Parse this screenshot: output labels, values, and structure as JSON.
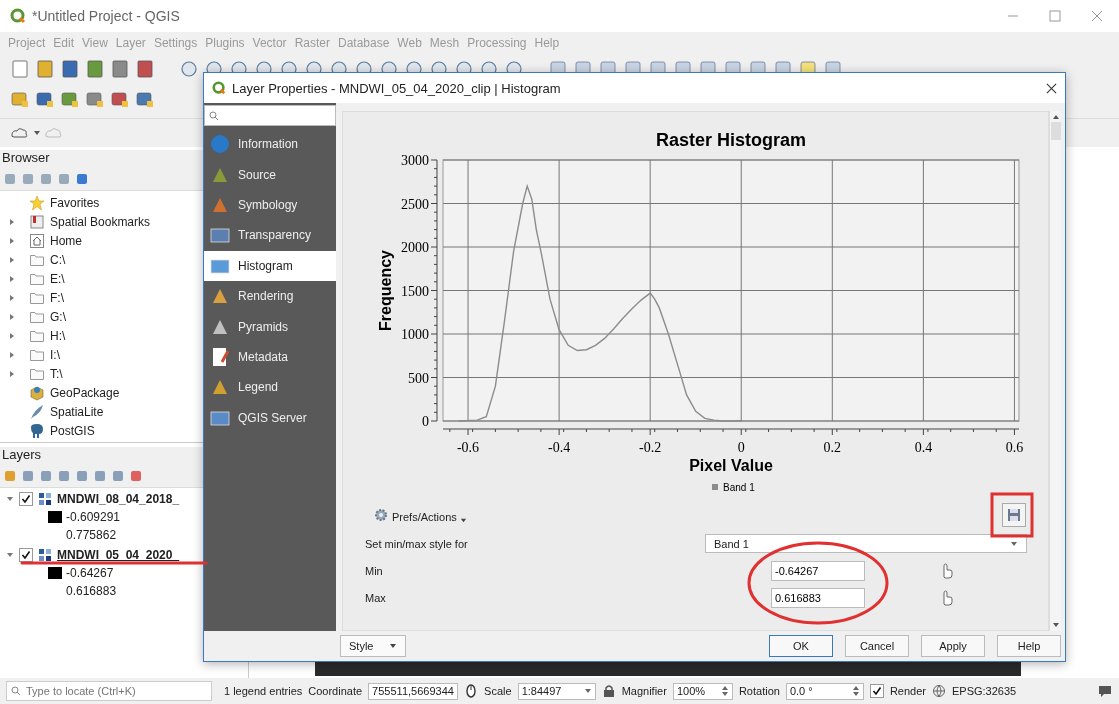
{
  "window": {
    "title": "*Untitled Project - QGIS"
  },
  "menu": [
    "Project",
    "Edit",
    "View",
    "Layer",
    "Settings",
    "Plugins",
    "Vector",
    "Raster",
    "Database",
    "Web",
    "Mesh",
    "Processing",
    "Help"
  ],
  "browser": {
    "title": "Browser",
    "items": [
      {
        "label": "Favorites"
      },
      {
        "label": "Spatial Bookmarks",
        "expanded": false
      },
      {
        "label": "Home",
        "expanded": false
      },
      {
        "label": "C:\\",
        "expanded": false
      },
      {
        "label": "E:\\",
        "expanded": false
      },
      {
        "label": "F:\\",
        "expanded": false
      },
      {
        "label": "G:\\",
        "expanded": false
      },
      {
        "label": "H:\\",
        "expanded": false
      },
      {
        "label": "I:\\",
        "expanded": false
      },
      {
        "label": "T:\\",
        "expanded": false
      },
      {
        "label": "GeoPackage"
      },
      {
        "label": "SpatiaLite"
      },
      {
        "label": "PostGIS"
      }
    ]
  },
  "layers_panel": {
    "title": "Layers",
    "layers": [
      {
        "name": "MNDWI_08_04_2018_",
        "checked": true,
        "expanded": true,
        "selected": false,
        "legend_min": "-0.609291",
        "legend_max": "0.775862"
      },
      {
        "name": "MNDWI_05_04_2020_",
        "checked": true,
        "expanded": true,
        "selected": true,
        "legend_min": "-0.64267",
        "legend_max": "0.616883"
      }
    ]
  },
  "dialog": {
    "title": "Layer Properties - MNDWI_05_04_2020_clip | Histogram",
    "sections": [
      {
        "label": "Information",
        "selected": false
      },
      {
        "label": "Source",
        "selected": false
      },
      {
        "label": "Symbology",
        "selected": false
      },
      {
        "label": "Transparency",
        "selected": false
      },
      {
        "label": "Histogram",
        "selected": true
      },
      {
        "label": "Rendering",
        "selected": false
      },
      {
        "label": "Pyramids",
        "selected": false
      },
      {
        "label": "Metadata",
        "selected": false
      },
      {
        "label": "Legend",
        "selected": false
      },
      {
        "label": "QGIS Server",
        "selected": false
      }
    ],
    "histogram": {
      "chart_data": {
        "type": "line",
        "grid": true,
        "title": "Raster Histogram",
        "xlabel": "Pixel Value",
        "ylabel": "Frequency",
        "xlim": [
          -0.655,
          0.61
        ],
        "ylim": [
          0,
          3000
        ],
        "xticks": [
          -0.6,
          -0.4,
          -0.2,
          0,
          0.2,
          0.4,
          0.6
        ],
        "yticks": [
          0,
          500,
          1000,
          1500,
          2000,
          2500,
          3000
        ],
        "x": [
          -0.62,
          -0.58,
          -0.56,
          -0.54,
          -0.52,
          -0.5,
          -0.48,
          -0.47,
          -0.46,
          -0.45,
          -0.44,
          -0.42,
          -0.4,
          -0.38,
          -0.36,
          -0.34,
          -0.32,
          -0.3,
          -0.28,
          -0.26,
          -0.24,
          -0.22,
          -0.2,
          -0.19,
          -0.18,
          -0.16,
          -0.14,
          -0.12,
          -0.1,
          -0.08,
          -0.06,
          -0.04,
          0
        ],
        "series": [
          {
            "name": "Band 1",
            "color": "#8c8c8c",
            "values": [
              0,
              10,
              50,
              400,
              1150,
              1950,
              2500,
              2700,
              2550,
              2200,
              1950,
              1400,
              1050,
              870,
              810,
              820,
              870,
              950,
              1060,
              1180,
              1290,
              1390,
              1470,
              1400,
              1300,
              1000,
              650,
              300,
              110,
              30,
              10,
              0,
              0
            ]
          }
        ]
      }
    },
    "prefs_label": "Prefs/Actions",
    "band_row": {
      "label": "Set min/max style for",
      "value": "Band 1"
    },
    "min": {
      "label": "Min",
      "value": "-0.64267"
    },
    "max": {
      "label": "Max",
      "value": "0.616883"
    },
    "style_button": "Style",
    "buttons": [
      "OK",
      "Cancel",
      "Apply",
      "Help"
    ]
  },
  "locator": {
    "placeholder": "Type to locate (Ctrl+K)"
  },
  "status_bar": {
    "message": "1 legend entries",
    "coordinate_label": "Coordinate",
    "coordinate": "755511,5669344",
    "scale_label": "Scale",
    "scale": "1:84497",
    "magnifier_label": "Magnifier",
    "magnifier": "100%",
    "rotation_label": "Rotation",
    "rotation": "0.0 °",
    "render": {
      "label": "Render",
      "checked": true
    },
    "crs": "EPSG:32635"
  }
}
